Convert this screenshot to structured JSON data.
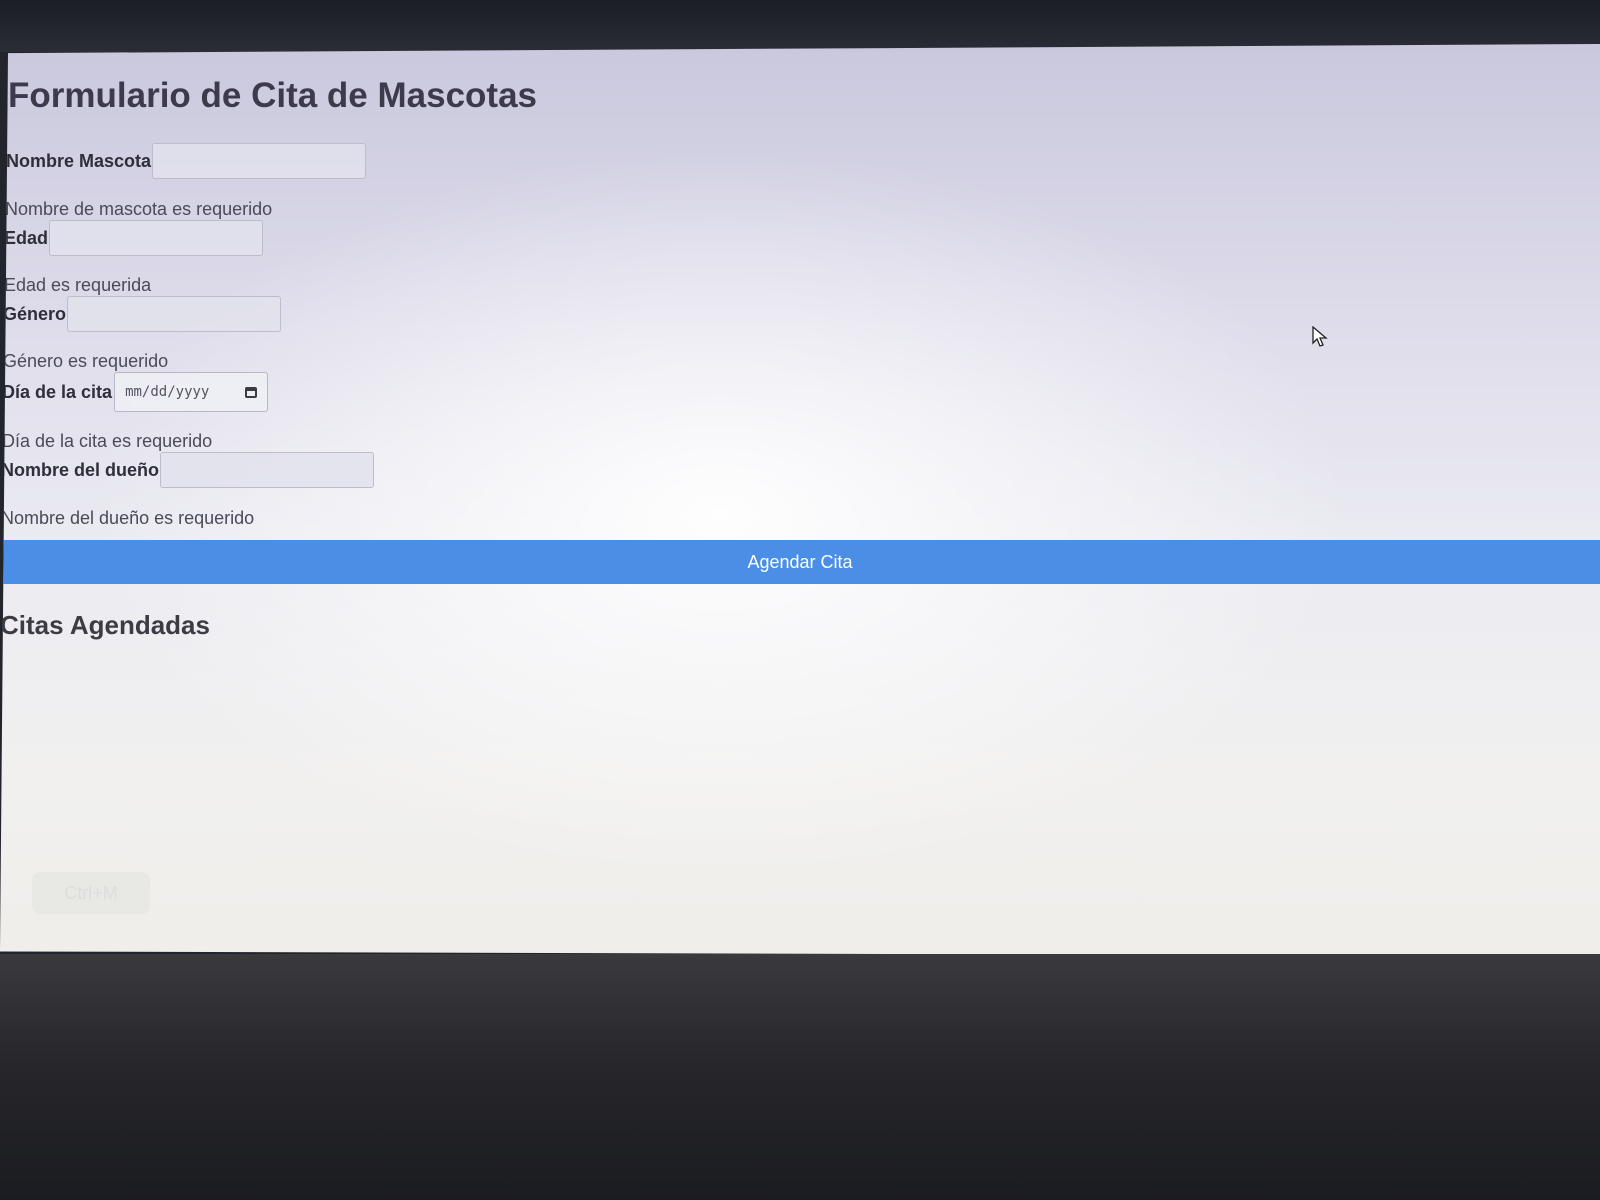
{
  "form": {
    "title": "Formulario de Cita de Mascotas",
    "fields": [
      {
        "label": "Nombre Mascota",
        "value": "",
        "error": "Nombre de mascota es requerido"
      },
      {
        "label": "Edad",
        "value": "",
        "error": "Edad es requerida"
      },
      {
        "label": "Género",
        "value": "",
        "error": "Género es requerido"
      },
      {
        "label": "Día de la cita",
        "placeholder": "mm/dd/yyyy",
        "error": "Día de la cita es requerido"
      },
      {
        "label": "Nombre del dueño",
        "value": "",
        "error": "Nombre del dueño es requerido"
      }
    ],
    "submit_label": "Agendar Cita"
  },
  "appointments": {
    "title": "Citas Agendadas"
  },
  "overlay": {
    "shortcut_label": "Ctrl+M"
  },
  "colors": {
    "submit_button": "#4a8ee6",
    "text": "#2f2e3b"
  },
  "icons": [
    "calendar-icon",
    "mouse-cursor-icon"
  ]
}
